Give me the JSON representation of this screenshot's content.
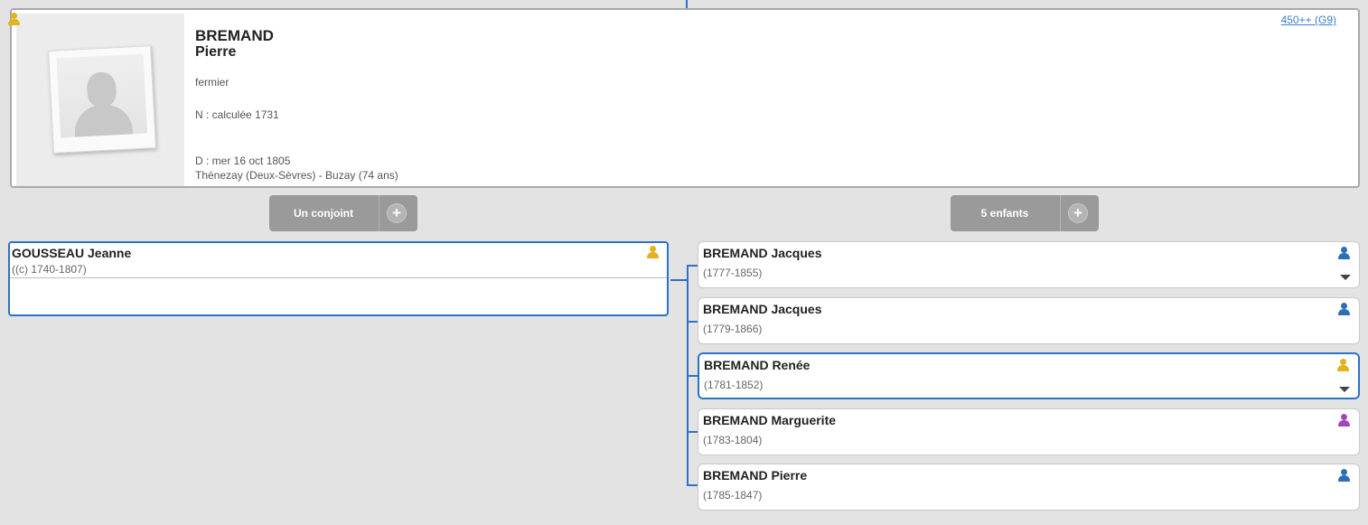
{
  "main_person": {
    "surname": "BREMAND",
    "firstname": "Pierre",
    "profession": "fermier",
    "birth": "N : calculée 1731",
    "death": "D : mer 16 oct 1805",
    "place": "Thénezay (Deux-Sèvres) - Buzay (74 ans)",
    "sosa_link": "450++ (G9)",
    "icon": "person-icon-yellow",
    "icon_color": "#e2b21f"
  },
  "buttons": {
    "spouse_label": "Un conjoint",
    "children_label": "5 enfants",
    "plus_glyph": "+"
  },
  "spouse": {
    "name": "GOUSSEAU Jeanne",
    "dates": "((c) 1740-1807)",
    "icon": "person-icon-yellow",
    "icon_color": "#e2b21f"
  },
  "children": [
    {
      "name": "BREMAND Jacques",
      "dates": "(1777-1855)",
      "icon": "person-icon-blue",
      "icon_color": "#2c6fb8",
      "expand": true
    },
    {
      "name": "BREMAND Jacques",
      "dates": "(1779-1866)",
      "icon": "person-icon-blue",
      "icon_color": "#2c6fb8",
      "expand": false
    },
    {
      "name": "BREMAND Renée",
      "dates": "(1781-1852)",
      "icon": "person-icon-yellow",
      "icon_color": "#e2b21f",
      "expand": true
    },
    {
      "name": "BREMAND Marguerite",
      "dates": "(1783-1804)",
      "icon": "person-icon-purple",
      "icon_color": "#a347b8",
      "expand": false
    },
    {
      "name": "BREMAND Pierre",
      "dates": "(1785-1847)",
      "icon": "person-icon-blue",
      "icon_color": "#2c6fb8",
      "expand": false
    }
  ],
  "colors": {
    "accent": "#2d72c8",
    "button_bg": "#9a9a9a",
    "page_bg": "#e3e3e3"
  }
}
